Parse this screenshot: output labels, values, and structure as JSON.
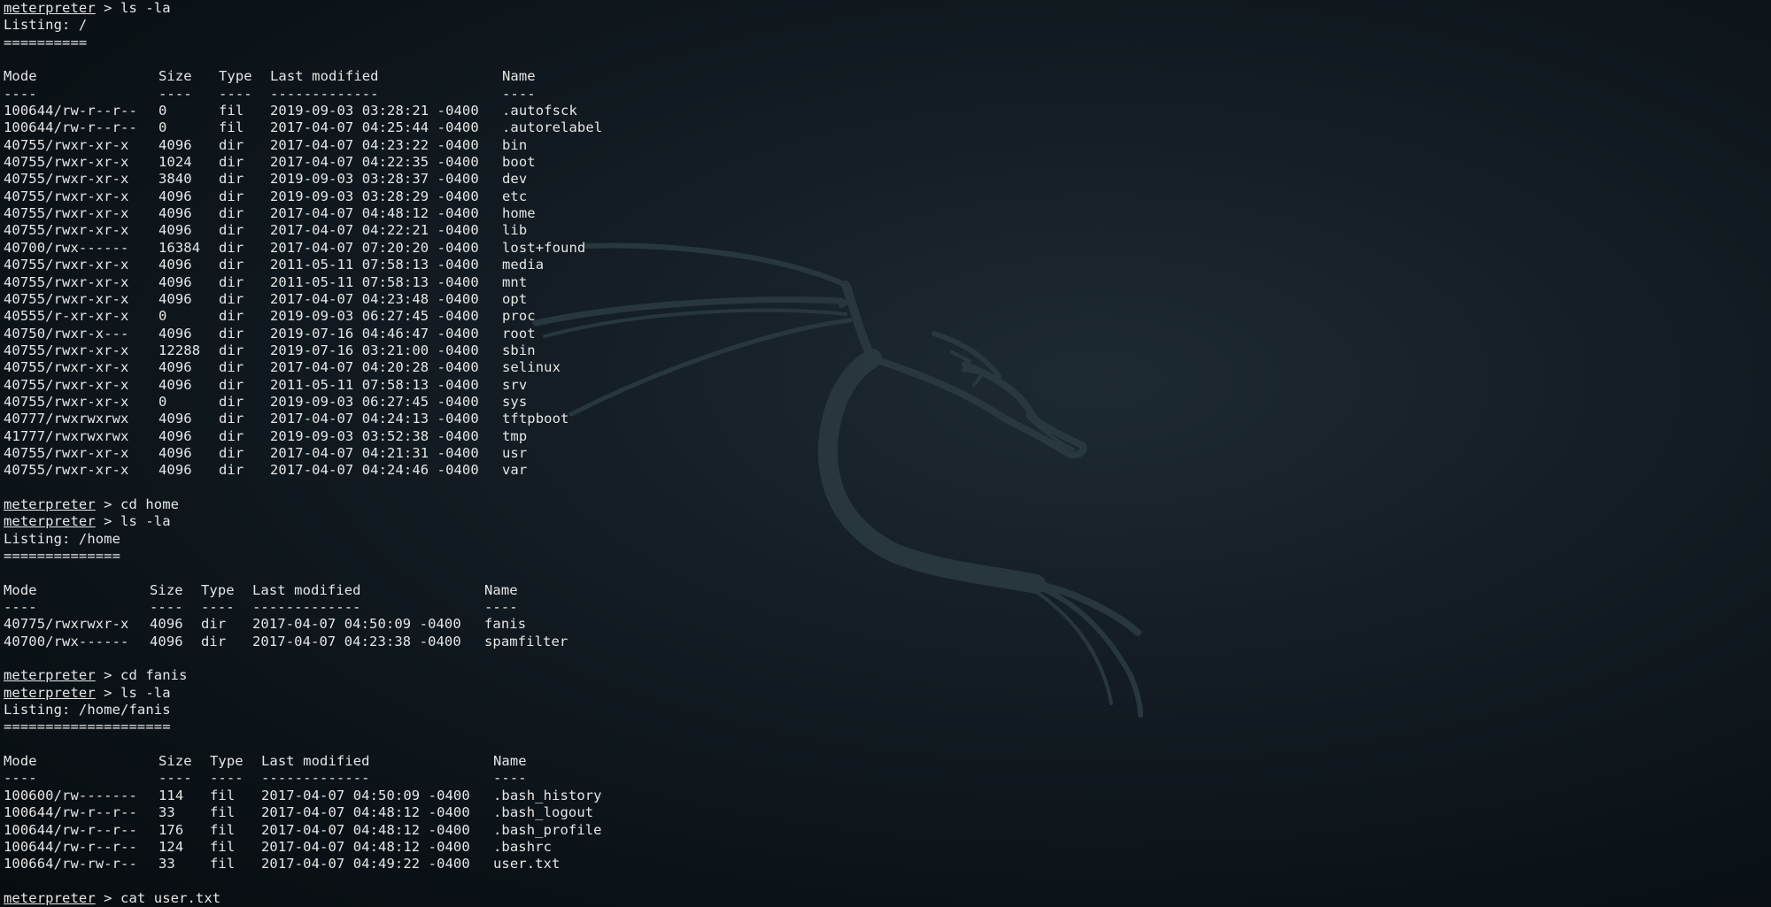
{
  "prompt": "meterpreter",
  "sections": [
    {
      "command": "ls -la",
      "listing": "Listing: /",
      "rule": "==========",
      "widths": [
        175,
        68,
        58,
        262
      ],
      "headers": [
        "Mode",
        "Size",
        "Type",
        "Last modified",
        "Name"
      ],
      "dashes": [
        "----",
        "----",
        "----",
        "-------------",
        "----"
      ],
      "rows": [
        [
          "100644/rw-r--r--",
          "0",
          "fil",
          "2019-09-03 03:28:21 -0400",
          ".autofsck"
        ],
        [
          "100644/rw-r--r--",
          "0",
          "fil",
          "2017-04-07 04:25:44 -0400",
          ".autorelabel"
        ],
        [
          "40755/rwxr-xr-x",
          "4096",
          "dir",
          "2017-04-07 04:23:22 -0400",
          "bin"
        ],
        [
          "40755/rwxr-xr-x",
          "1024",
          "dir",
          "2017-04-07 04:22:35 -0400",
          "boot"
        ],
        [
          "40755/rwxr-xr-x",
          "3840",
          "dir",
          "2019-09-03 03:28:37 -0400",
          "dev"
        ],
        [
          "40755/rwxr-xr-x",
          "4096",
          "dir",
          "2019-09-03 03:28:29 -0400",
          "etc"
        ],
        [
          "40755/rwxr-xr-x",
          "4096",
          "dir",
          "2017-04-07 04:48:12 -0400",
          "home"
        ],
        [
          "40755/rwxr-xr-x",
          "4096",
          "dir",
          "2017-04-07 04:22:21 -0400",
          "lib"
        ],
        [
          "40700/rwx------",
          "16384",
          "dir",
          "2017-04-07 07:20:20 -0400",
          "lost+found"
        ],
        [
          "40755/rwxr-xr-x",
          "4096",
          "dir",
          "2011-05-11 07:58:13 -0400",
          "media"
        ],
        [
          "40755/rwxr-xr-x",
          "4096",
          "dir",
          "2011-05-11 07:58:13 -0400",
          "mnt"
        ],
        [
          "40755/rwxr-xr-x",
          "4096",
          "dir",
          "2017-04-07 04:23:48 -0400",
          "opt"
        ],
        [
          "40555/r-xr-xr-x",
          "0",
          "dir",
          "2019-09-03 06:27:45 -0400",
          "proc"
        ],
        [
          "40750/rwxr-x---",
          "4096",
          "dir",
          "2019-07-16 04:46:47 -0400",
          "root"
        ],
        [
          "40755/rwxr-xr-x",
          "12288",
          "dir",
          "2019-07-16 03:21:00 -0400",
          "sbin"
        ],
        [
          "40755/rwxr-xr-x",
          "4096",
          "dir",
          "2017-04-07 04:20:28 -0400",
          "selinux"
        ],
        [
          "40755/rwxr-xr-x",
          "4096",
          "dir",
          "2011-05-11 07:58:13 -0400",
          "srv"
        ],
        [
          "40755/rwxr-xr-x",
          "0",
          "dir",
          "2019-09-03 06:27:45 -0400",
          "sys"
        ],
        [
          "40777/rwxrwxrwx",
          "4096",
          "dir",
          "2017-04-07 04:24:13 -0400",
          "tftpboot"
        ],
        [
          "41777/rwxrwxrwx",
          "4096",
          "dir",
          "2019-09-03 03:52:38 -0400",
          "tmp"
        ],
        [
          "40755/rwxr-xr-x",
          "4096",
          "dir",
          "2017-04-07 04:21:31 -0400",
          "usr"
        ],
        [
          "40755/rwxr-xr-x",
          "4096",
          "dir",
          "2017-04-07 04:24:46 -0400",
          "var"
        ]
      ]
    },
    {
      "pre_command": "cd home",
      "command": "ls -la",
      "listing": "Listing: /home",
      "rule": "==============",
      "widths": [
        165,
        58,
        58,
        262
      ],
      "headers": [
        "Mode",
        "Size",
        "Type",
        "Last modified",
        "Name"
      ],
      "dashes": [
        "----",
        "----",
        "----",
        "-------------",
        "----"
      ],
      "rows": [
        [
          "40775/rwxrwxr-x",
          "4096",
          "dir",
          "2017-04-07 04:50:09 -0400",
          "fanis"
        ],
        [
          "40700/rwx------",
          "4096",
          "dir",
          "2017-04-07 04:23:38 -0400",
          "spamfilter"
        ]
      ]
    },
    {
      "pre_command": "cd fanis",
      "command": "ls -la",
      "listing": "Listing: /home/fanis",
      "rule": "====================",
      "widths": [
        175,
        58,
        58,
        262
      ],
      "headers": [
        "Mode",
        "Size",
        "Type",
        "Last modified",
        "Name"
      ],
      "dashes": [
        "----",
        "----",
        "----",
        "-------------",
        "----"
      ],
      "rows": [
        [
          "100600/rw-------",
          "114",
          "fil",
          "2017-04-07 04:50:09 -0400",
          ".bash_history"
        ],
        [
          "100644/rw-r--r--",
          "33",
          "fil",
          "2017-04-07 04:48:12 -0400",
          ".bash_logout"
        ],
        [
          "100644/rw-r--r--",
          "176",
          "fil",
          "2017-04-07 04:48:12 -0400",
          ".bash_profile"
        ],
        [
          "100644/rw-r--r--",
          "124",
          "fil",
          "2017-04-07 04:48:12 -0400",
          ".bashrc"
        ],
        [
          "100664/rw-rw-r--",
          "33",
          "fil",
          "2017-04-07 04:49:22 -0400",
          "user.txt"
        ]
      ]
    }
  ],
  "final_command": "cat user.txt",
  "colors": {
    "text": "#e6e6e6",
    "logo": "#2e3d45",
    "background": "#0f181d"
  }
}
